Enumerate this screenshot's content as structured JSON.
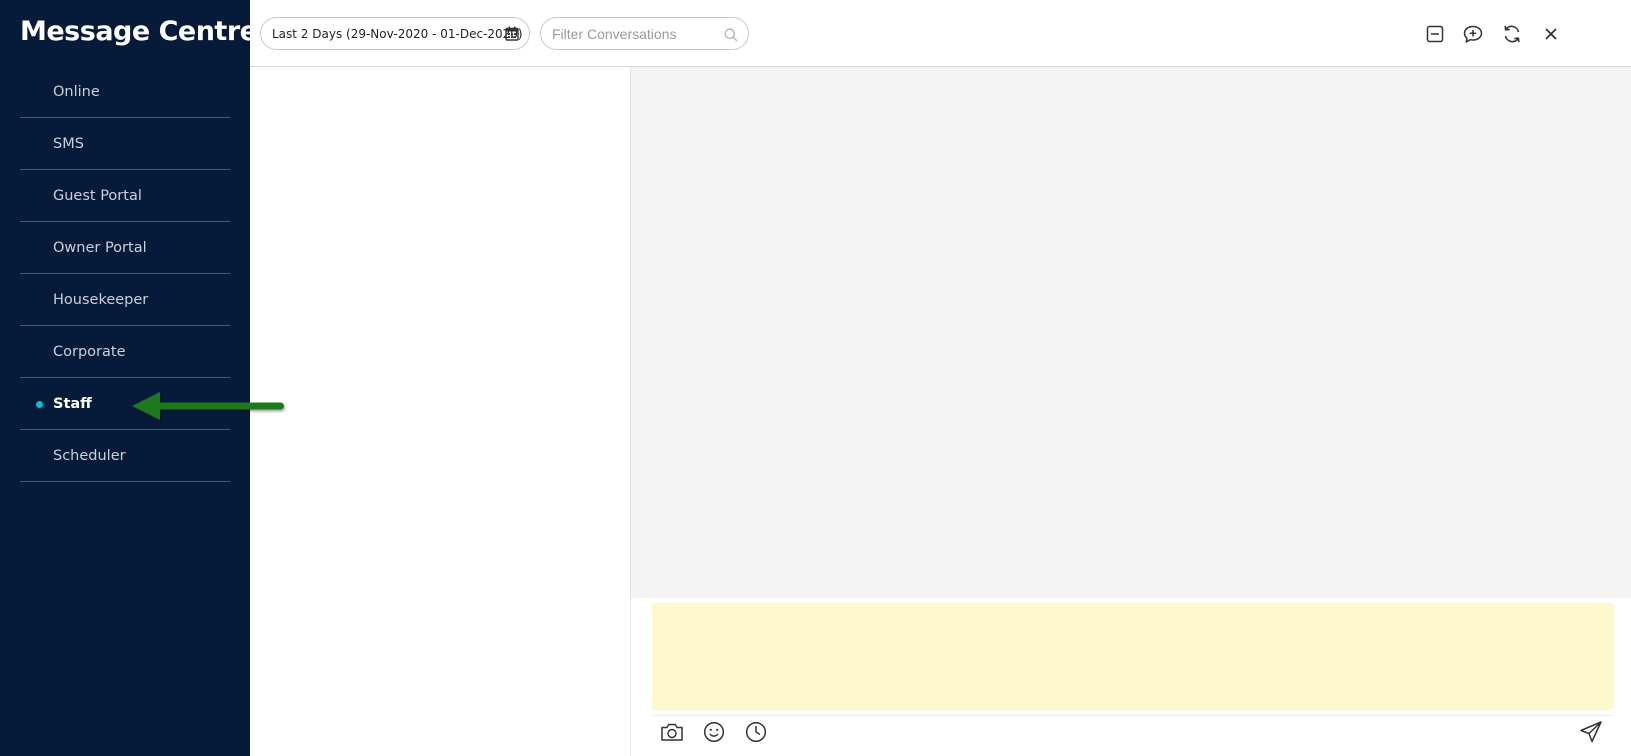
{
  "app": {
    "title": "Message Centre"
  },
  "nav": {
    "items": [
      {
        "label": "Online"
      },
      {
        "label": "SMS"
      },
      {
        "label": "Guest Portal"
      },
      {
        "label": "Owner Portal"
      },
      {
        "label": "Housekeeper"
      },
      {
        "label": "Corporate"
      },
      {
        "label": "Staff",
        "active": true
      },
      {
        "label": "Scheduler"
      }
    ]
  },
  "toolbar": {
    "date_range": "Last 2 Days (29-Nov-2020 - 01-Dec-2020)",
    "filter_placeholder": "Filter Conversations",
    "icons": [
      "calendar-icon",
      "search-icon",
      "minimize-icon",
      "new-message-icon",
      "refresh-icon",
      "close-icon"
    ]
  },
  "composer": {
    "icons": [
      "camera-icon",
      "emoji-icon",
      "clock-icon",
      "send-icon"
    ]
  },
  "colors": {
    "sidebar_bg": "#061b39",
    "active_dot": "#00c2d8",
    "arrow": "#1a7a1a",
    "composer_bg": "#fef8cc",
    "chat_bg": "#f3f3f3"
  }
}
